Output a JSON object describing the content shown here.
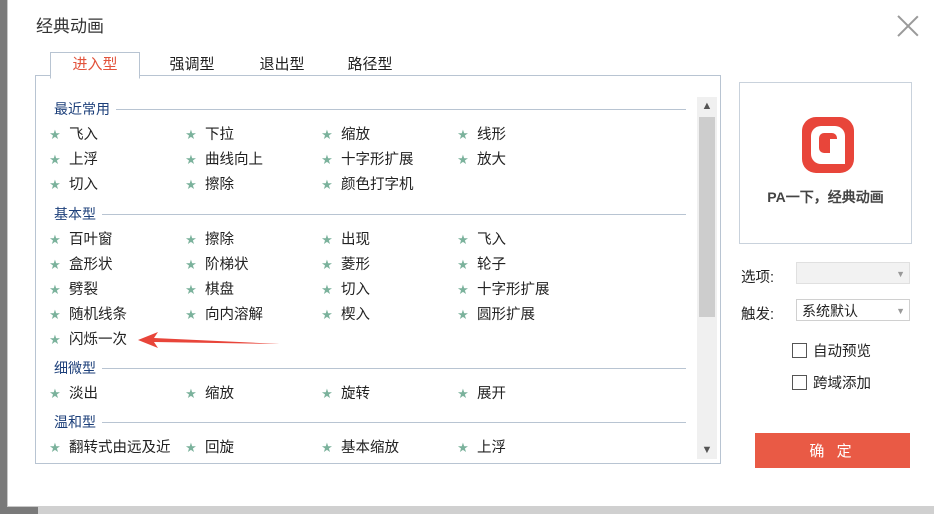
{
  "dialog": {
    "title": "经典动画"
  },
  "tabs": [
    "进入型",
    "强调型",
    "退出型",
    "路径型"
  ],
  "sections": [
    {
      "title": "最近常用",
      "items": [
        "飞入",
        "下拉",
        "缩放",
        "线形",
        "上浮",
        "曲线向上",
        "十字形扩展",
        "放大",
        "切入",
        "擦除",
        "颜色打字机"
      ]
    },
    {
      "title": "基本型",
      "items": [
        "百叶窗",
        "擦除",
        "出现",
        "飞入",
        "盒形状",
        "阶梯状",
        "菱形",
        "轮子",
        "劈裂",
        "棋盘",
        "切入",
        "十字形扩展",
        "随机线条",
        "向内溶解",
        "楔入",
        "圆形扩展",
        "闪烁一次"
      ]
    },
    {
      "title": "细微型",
      "items": [
        "淡出",
        "缩放",
        "旋转",
        "展开"
      ]
    },
    {
      "title": "温和型",
      "items": [
        "翻转式由远及近",
        "回旋",
        "基本缩放",
        "上浮"
      ]
    }
  ],
  "preview": {
    "caption": "PA一下，经典动画"
  },
  "options": {
    "option_label": "选项:",
    "option_value": "",
    "trigger_label": "触发:",
    "trigger_value": "系统默认",
    "auto_preview": "自动预览",
    "cross_domain": "跨域添加"
  },
  "ok_label": "确 定",
  "colors": {
    "accent": "#e95a45",
    "star": "#7bb29c",
    "section_title": "#1c3f7a"
  },
  "icons": [
    "close-icon",
    "star-icon",
    "scroll-up-icon",
    "scroll-down-icon",
    "pa-logo-icon",
    "red-arrow-icon",
    "chevron-down-icon"
  ]
}
